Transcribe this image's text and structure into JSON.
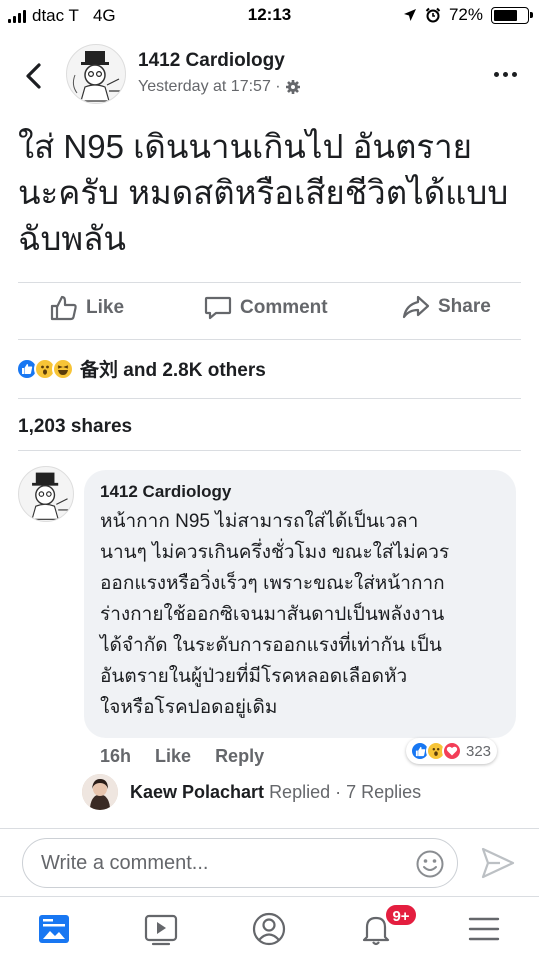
{
  "status_bar": {
    "carrier": "dtac T",
    "network": "4G",
    "time": "12:13",
    "battery": "72%",
    "battery_level": 0.72
  },
  "header": {
    "page_name": "1412 Cardiology",
    "post_time": "Yesterday at 17:57 ·",
    "back_icon": "chevron-left-icon",
    "more_icon": "ellipsis-icon",
    "privacy_icon": "gear-icon"
  },
  "post": {
    "lines": [
      "ใส่ N95 เดินนานเกินไป อันตราย",
      "นะครับ หมดสติหรือเสียชีวิตได้แบบ",
      "ฉับพลัน"
    ]
  },
  "actions": {
    "like": "Like",
    "comment": "Comment",
    "share": "Share"
  },
  "reactions": {
    "text": "备刘 and 2.8K others",
    "types": [
      "like",
      "wow",
      "haha"
    ]
  },
  "shares": "1,203 shares",
  "comment": {
    "author": "1412 Cardiology",
    "lines": [
      "หน้ากาก N95 ไม่สามารถใส่ได้เป็นเวลา",
      "นานๆ ไม่ควรเกินครึ่งชั่วโมง ขณะใส่ไม่ควร",
      "ออกแรงหรือวิ่งเร็วๆ เพราะขณะใส่หน้ากาก",
      "ร่างกายใช้ออกซิเจนมาสันดาปเป็นพลังงาน",
      "ได้จำกัด ในระดับการออกแรงที่เท่ากัน เป็น",
      "อันตรายในผู้ป่วยที่มีโรคหลอดเลือดหัว",
      "ใจหรือโรคปอดอยู่เดิม"
    ],
    "age": "16h",
    "like": "Like",
    "reply": "Reply",
    "reaction_count": "323",
    "reaction_types": [
      "like",
      "wow",
      "love"
    ]
  },
  "replies": {
    "name": "Kaew Polachart",
    "action": "Replied",
    "count": "· 7 Replies"
  },
  "composer": {
    "placeholder": "Write a comment..."
  },
  "tabbar": {
    "tabs": [
      "news-feed-icon",
      "video-icon",
      "profile-icon",
      "notifications-icon",
      "menu-icon"
    ],
    "notification_badge": "9+"
  },
  "colors": {
    "accent": "#1877f2",
    "text": "#1c1e21",
    "muted": "#65676b",
    "badge": "#e41e3f"
  }
}
